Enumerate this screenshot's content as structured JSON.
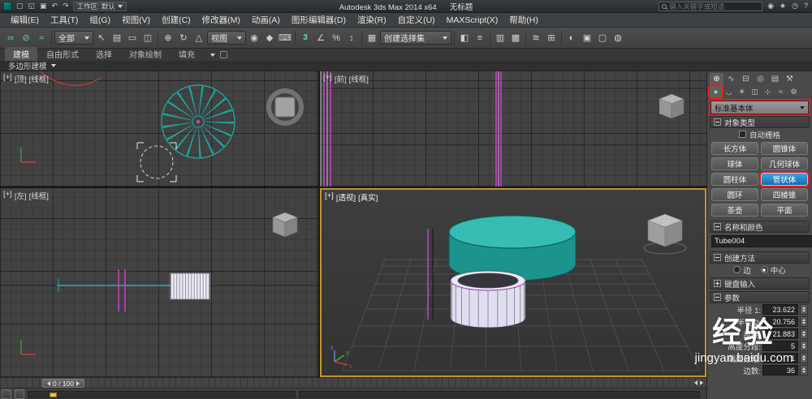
{
  "titlebar": {
    "workspace": "工作区: 默认",
    "title": "Autodesk 3ds Max  2014 x64",
    "doc": "无标题",
    "search_placeholder": "键入关键字或短语",
    "quick_icons": [
      {
        "name": "new-scene",
        "glyph": "▢"
      },
      {
        "name": "open-file",
        "glyph": "◱"
      },
      {
        "name": "save-file",
        "glyph": "▣"
      },
      {
        "name": "undo",
        "glyph": "↶"
      },
      {
        "name": "redo",
        "glyph": "↷"
      }
    ],
    "right_icons": [
      {
        "name": "sign-in",
        "glyph": "◉"
      },
      {
        "name": "favorites",
        "glyph": "★"
      },
      {
        "name": "history",
        "glyph": "◷"
      },
      {
        "name": "help",
        "glyph": "?"
      }
    ]
  },
  "menubar": {
    "items": [
      "编辑(E)",
      "工具(T)",
      "组(G)",
      "视图(V)",
      "创建(C)",
      "修改器(M)",
      "动画(A)",
      "图形编辑器(D)",
      "渲染(R)",
      "自定义(U)",
      "MAXScript(X)",
      "帮助(H)"
    ]
  },
  "toolbar": {
    "filter_value": "全部",
    "coord_value": "视图",
    "sets_value": "创建选择集",
    "icons": [
      {
        "name": "select-and-link",
        "glyph": "∞"
      },
      {
        "name": "unlink-selection",
        "glyph": "⊘"
      },
      {
        "name": "bind-to-space-warp",
        "glyph": "≈"
      },
      {
        "name": "select-object",
        "glyph": "↖"
      },
      {
        "name": "select-by-name",
        "glyph": "▤"
      },
      {
        "name": "rectangular-selection-region",
        "glyph": "▭"
      },
      {
        "name": "window-crossing-toggle",
        "glyph": "◫"
      },
      {
        "name": "select-and-move",
        "glyph": "⊕"
      },
      {
        "name": "select-and-rotate",
        "glyph": "↻"
      },
      {
        "name": "select-and-scale",
        "glyph": "△"
      },
      {
        "name": "use-pivot-point-center",
        "glyph": "◉"
      },
      {
        "name": "select-and-manipulate",
        "glyph": "◆"
      },
      {
        "name": "keyboard-shortcut-override",
        "glyph": "⌨"
      },
      {
        "name": "snap-toggle-3d",
        "glyph": "3"
      },
      {
        "name": "angle-snap-toggle",
        "glyph": "∠"
      },
      {
        "name": "percent-snap-toggle",
        "glyph": "%"
      },
      {
        "name": "spinner-snap-toggle",
        "glyph": "↕"
      },
      {
        "name": "edit-named-selection-sets",
        "glyph": "▦"
      },
      {
        "name": "mirror",
        "glyph": "◧"
      },
      {
        "name": "align",
        "glyph": "≡"
      },
      {
        "name": "layer-manager",
        "glyph": "▥"
      },
      {
        "name": "graphite-ribbon-toggle",
        "glyph": "▩"
      },
      {
        "name": "curve-editor",
        "glyph": "≋"
      },
      {
        "name": "schematic-view",
        "glyph": "⊞"
      },
      {
        "name": "material-editor",
        "glyph": "◐"
      },
      {
        "name": "render-setup",
        "glyph": "▣"
      },
      {
        "name": "rendered-frame-window",
        "glyph": "▢"
      },
      {
        "name": "render-production",
        "glyph": "◍"
      }
    ]
  },
  "ribbon": {
    "tabs": [
      "建模",
      "自由形式",
      "选择",
      "对象绘制",
      "填充"
    ],
    "subtab": "多边形建模"
  },
  "viewports": {
    "top": {
      "plus": "[+]",
      "name": "[顶]",
      "shading": "[线框]"
    },
    "front": {
      "plus": "[+]",
      "name": "[前]",
      "shading": "[线框]"
    },
    "left": {
      "plus": "[+]",
      "name": "[左]",
      "shading": "[线框]"
    },
    "perspective": {
      "plus": "[+]",
      "name": "[透视]",
      "shading": "[真实]",
      "gizmo": [
        "x",
        "y",
        "z"
      ]
    }
  },
  "command_panel": {
    "panel_tabs": [
      {
        "name": "create-tab",
        "glyph": "⊕"
      },
      {
        "name": "modify-tab",
        "glyph": "∿"
      },
      {
        "name": "hierarchy-tab",
        "glyph": "⊟"
      },
      {
        "name": "motion-tab",
        "glyph": "◎"
      },
      {
        "name": "display-tab",
        "glyph": "▤"
      },
      {
        "name": "utilities-tab",
        "glyph": "⚒"
      }
    ],
    "panel_subtabs": [
      {
        "name": "geometry",
        "glyph": "●"
      },
      {
        "name": "shapes",
        "glyph": "◡"
      },
      {
        "name": "lights",
        "glyph": "☀"
      },
      {
        "name": "cameras",
        "glyph": "◫"
      },
      {
        "name": "helpers",
        "glyph": "⊹"
      },
      {
        "name": "space-warps",
        "glyph": "≈"
      },
      {
        "name": "systems",
        "glyph": "⚙"
      }
    ],
    "category_select": "标准基本体",
    "rollout_object_type": "对象类型",
    "autogrid_label": "自动栅格",
    "object_buttons": [
      "长方体",
      "圆锥体",
      "球体",
      "几何球体",
      "圆柱体",
      "管状体",
      "圆环",
      "四棱锥",
      "茶壶",
      "平面"
    ],
    "selected_object_type": "管状体",
    "rollout_name_color": "名称和颜色",
    "object_name": "Tube004",
    "rollout_creation": "创建方法",
    "creation_edge": "边",
    "creation_center": "中心",
    "rollout_keyboard": "键盘输入",
    "rollout_params": "参数",
    "params": [
      {
        "label": "半径 1:",
        "value": "23.622"
      },
      {
        "label": "半径 2:",
        "value": "20.756"
      },
      {
        "label": "高度:",
        "value": "21.883"
      },
      {
        "label": "高度分段:",
        "value": "5"
      },
      {
        "label": "端面分段:",
        "value": "1"
      },
      {
        "label": "边数:",
        "value": "36"
      }
    ]
  },
  "timeline": {
    "slider_label": "0 / 100"
  },
  "watermark": {
    "cn": "经验",
    "url": "jingyan.baidu.com"
  }
}
